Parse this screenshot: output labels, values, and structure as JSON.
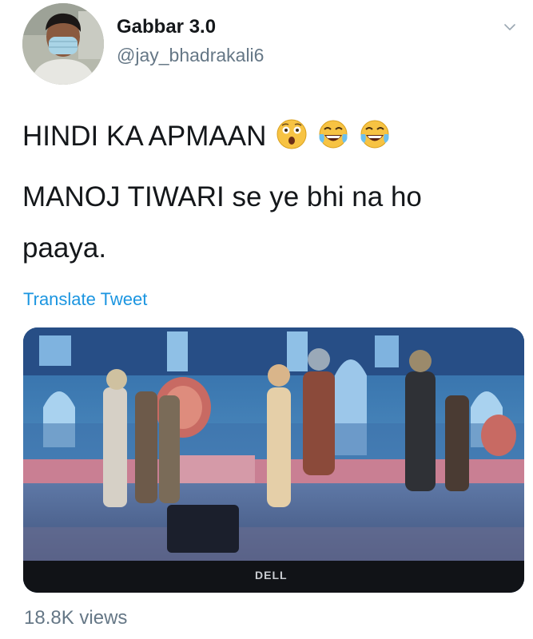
{
  "user": {
    "display_name": "Gabbar 3.0",
    "handle": "@jay_bhadrakali6"
  },
  "tweet": {
    "line1": "HINDI KA APMAAN",
    "line2": "MANOJ TIWARI se ye bhi na ho",
    "line3": "paaya.",
    "emojis": [
      "astonished-face-emoji",
      "face-with-tears-of-joy-emoji",
      "face-with-tears-of-joy-emoji"
    ]
  },
  "translate_label": "Translate Tweet",
  "media": {
    "monitor_brand": "DELL"
  },
  "views_label": "18.8K views"
}
